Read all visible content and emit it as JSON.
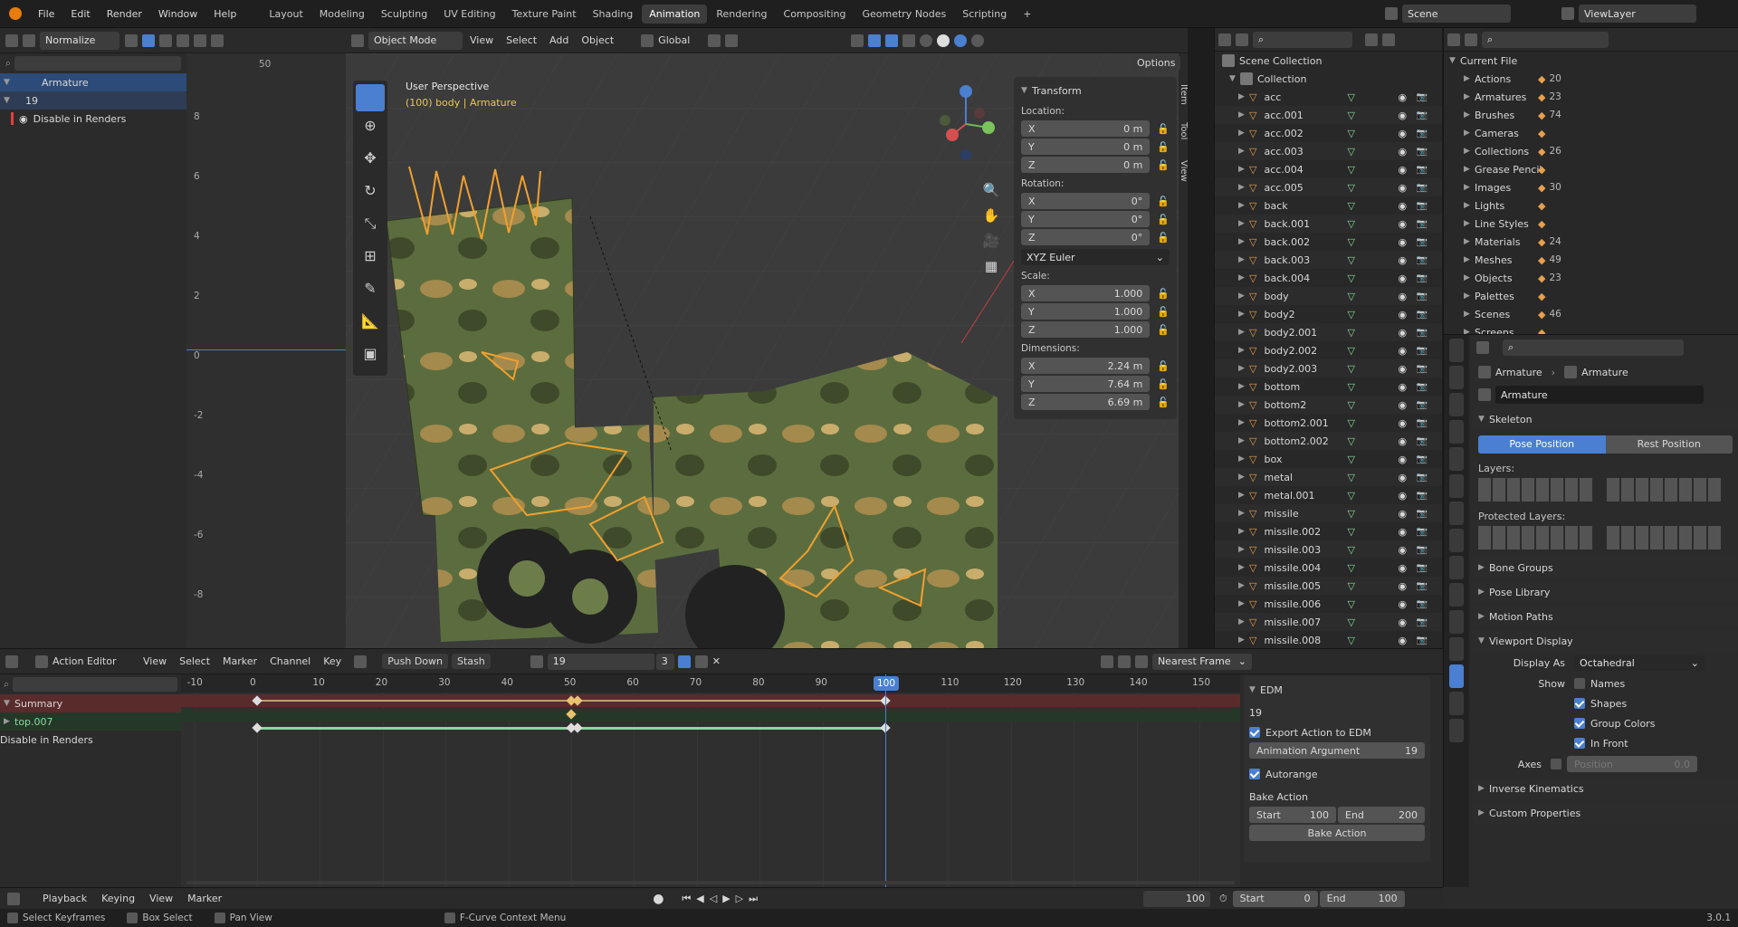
{
  "topbar": {
    "menus": [
      "File",
      "Edit",
      "Render",
      "Window",
      "Help"
    ],
    "workspaces": [
      "Layout",
      "Modeling",
      "Sculpting",
      "UV Editing",
      "Texture Paint",
      "Shading",
      "Animation",
      "Rendering",
      "Compositing",
      "Geometry Nodes",
      "Scripting"
    ],
    "active_workspace": "Animation",
    "scene": "Scene",
    "view_layer": "ViewLayer"
  },
  "dopesheet_top": {
    "normalize": "Normalize",
    "axis_labels": [
      "8",
      "6",
      "4",
      "2",
      "0",
      "-2",
      "-4",
      "-6",
      "-8"
    ],
    "ruler_marks": [
      "50"
    ],
    "channels": [
      {
        "label": "Armature"
      },
      {
        "label": "19"
      },
      {
        "label": "Disable in Renders"
      }
    ]
  },
  "viewport": {
    "mode": "Object Mode",
    "menus": [
      "View",
      "Select",
      "Add",
      "Object"
    ],
    "orientation": "Global",
    "options": "Options",
    "title": "User Perspective",
    "subtitle": "(100) body | Armature",
    "side_tabs": [
      "Item",
      "Tool",
      "View"
    ],
    "transform": {
      "title": "Transform",
      "location_label": "Location:",
      "location": [
        {
          "axis": "X",
          "value": "0 m"
        },
        {
          "axis": "Y",
          "value": "0 m"
        },
        {
          "axis": "Z",
          "value": "0 m"
        }
      ],
      "rotation_label": "Rotation:",
      "rotation": [
        {
          "axis": "X",
          "value": "0°"
        },
        {
          "axis": "Y",
          "value": "0°"
        },
        {
          "axis": "Z",
          "value": "0°"
        }
      ],
      "rotation_mode": "XYZ Euler",
      "scale_label": "Scale:",
      "scale": [
        {
          "axis": "X",
          "value": "1.000"
        },
        {
          "axis": "Y",
          "value": "1.000"
        },
        {
          "axis": "Z",
          "value": "1.000"
        }
      ],
      "dimensions_label": "Dimensions:",
      "dimensions": [
        {
          "axis": "X",
          "value": "2.24 m"
        },
        {
          "axis": "Y",
          "value": "7.64 m"
        },
        {
          "axis": "Z",
          "value": "6.69 m"
        }
      ]
    }
  },
  "outliner": {
    "root": "Scene Collection",
    "collection": "Collection",
    "items": [
      "acc",
      "acc.001",
      "acc.002",
      "acc.003",
      "acc.004",
      "acc.005",
      "back",
      "back.001",
      "back.002",
      "back.003",
      "back.004",
      "body",
      "body2",
      "body2.001",
      "body2.002",
      "body2.003",
      "bottom",
      "bottom2",
      "bottom2.001",
      "bottom2.002",
      "box",
      "metal",
      "metal.001",
      "missile",
      "missile.002",
      "missile.003",
      "missile.004",
      "missile.005",
      "missile.006",
      "missile.007",
      "missile.008"
    ]
  },
  "blend_file": {
    "root": "Current File",
    "items": [
      {
        "label": "Actions",
        "count": "20"
      },
      {
        "label": "Armatures",
        "count": "23"
      },
      {
        "label": "Brushes",
        "count": "74"
      },
      {
        "label": "Cameras",
        "count": ""
      },
      {
        "label": "Collections",
        "count": "26"
      },
      {
        "label": "Grease Pencil",
        "count": ""
      },
      {
        "label": "Images",
        "count": "30"
      },
      {
        "label": "Lights",
        "count": ""
      },
      {
        "label": "Line Styles",
        "count": ""
      },
      {
        "label": "Materials",
        "count": "24"
      },
      {
        "label": "Meshes",
        "count": "49"
      },
      {
        "label": "Objects",
        "count": "23"
      },
      {
        "label": "Palettes",
        "count": ""
      },
      {
        "label": "Scenes",
        "count": "46"
      },
      {
        "label": "Screens",
        "count": ""
      }
    ]
  },
  "properties": {
    "breadcrumb_a": "Armature",
    "breadcrumb_b": "Armature",
    "data_name": "Armature",
    "skeleton": "Skeleton",
    "pose_position": "Pose Position",
    "rest_position": "Rest Position",
    "layers": "Layers:",
    "protected_layers": "Protected Layers:",
    "bone_groups": "Bone Groups",
    "pose_library": "Pose Library",
    "motion_paths": "Motion Paths",
    "viewport_display": "Viewport Display",
    "display_as_label": "Display As",
    "display_as": "Octahedral",
    "show_label": "Show",
    "show_names": "Names",
    "show_shapes": "Shapes",
    "show_group_colors": "Group Colors",
    "show_in_front": "In Front",
    "axes_label": "Axes",
    "axes_position": "Position",
    "axes_value": "0.0",
    "inverse_kinematics": "Inverse Kinematics",
    "custom_properties": "Custom Properties"
  },
  "action_editor": {
    "mode": "Action Editor",
    "menus": [
      "View",
      "Select",
      "Marker",
      "Channel",
      "Key"
    ],
    "push_down": "Push Down",
    "stash": "Stash",
    "action": "19",
    "users": "3",
    "snapping": "Nearest Frame",
    "frame_ticks": [
      "-10",
      "0",
      "10",
      "20",
      "30",
      "40",
      "50",
      "60",
      "70",
      "80",
      "90",
      "100",
      "110",
      "120",
      "130",
      "140",
      "150"
    ],
    "current_frame": "100",
    "channels": [
      "Summary",
      "top.007",
      "Disable in Renders"
    ],
    "edm": {
      "title": "EDM",
      "action_name": "19",
      "export_label": "Export Action to EDM",
      "arg_label": "Animation Argument",
      "arg_value": "19",
      "autorange": "Autorange",
      "bake_label": "Bake Action",
      "start_label": "Start",
      "start_value": "100",
      "end_label": "End",
      "end_value": "200",
      "bake_button": "Bake Action"
    }
  },
  "timeline": {
    "menus": [
      "Playback",
      "Keying",
      "View",
      "Marker"
    ],
    "frame": "100",
    "start_label": "Start",
    "start": "0",
    "end_label": "End",
    "end": "100"
  },
  "statusbar": {
    "items": [
      "Select Keyframes",
      "Box Select",
      "Pan View",
      "F-Curve Context Menu"
    ],
    "version": "3.0.1"
  },
  "colors": {
    "accent": "#4a7fd1",
    "keyframe": "#e8a04b",
    "bone": "#f0a030",
    "green": "#8bd7a0"
  }
}
